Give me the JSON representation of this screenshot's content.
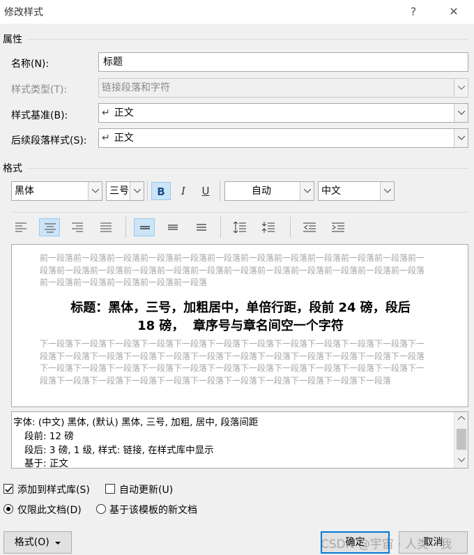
{
  "window": {
    "title": "修改样式",
    "help_glyph": "?",
    "close_glyph": "✕"
  },
  "properties": {
    "section_label": "属性",
    "name_label": "名称(N):",
    "name_value": "标题",
    "type_label": "样式类型(T):",
    "type_value": "链接段落和字符",
    "based_on_label": "样式基准(B):",
    "based_on_value": "正文",
    "next_label": "后续段落样式(S):",
    "next_value": "正文",
    "para_mark": "↵"
  },
  "format": {
    "section_label": "格式",
    "font": "黑体",
    "size": "三号",
    "bold": "B",
    "italic": "I",
    "underline": "U",
    "color": "自动",
    "script": "中文"
  },
  "preview": {
    "before_text": "前一段落前一段落前一段落前一段落前一段落前一段落前一段落前一段落前一段落前一段落前一段落前一段落前一段落前一段落前一段落前一段落前一段落前一段落前一段落前一段落前一段落前一段落前一段落前一段落前一段落前一段落前一段落前一段落",
    "sample_line1": "标题：黑体，三号，加粗居中，单倍行距，段前 24 磅，段后",
    "sample_line2": "18 磅，  章序号与章名间空一个字符",
    "after_text": "下一段落下一段落下一段落下一段落下一段落下一段落下一段落下一段落下一段落下一段落下一段落下一段落下一段落下一段落下一段落下一段落下一段落下一段落下一段落下一段落下一段落下一段落下一段落下一段落下一段落下一段落下一段落下一段落下一段落下一段落下一段落下一段落下一段落下一段落下一段落下一段落下一段落下一段落下一段落下一段落下一段落下一段落下一段落下一段落下一段落"
  },
  "description": {
    "line1": "字体: (中文) 黑体, (默认) 黑体, 三号, 加粗, 居中, 段落间距",
    "line2": "段前: 12 磅",
    "line3": "段后: 3 磅, 1 级, 样式: 链接, 在样式库中显示",
    "line4": "基于: 正文"
  },
  "options": {
    "add_to_gallery": "添加到样式库(S)",
    "add_to_gallery_checked": true,
    "auto_update": "自动更新(U)",
    "auto_update_checked": false,
    "only_this_doc": "仅限此文档(D)",
    "only_this_doc_selected": true,
    "new_docs_template": "基于该模板的新文档",
    "new_docs_template_selected": false
  },
  "buttons": {
    "format": "格式(O)",
    "ok": "确定",
    "cancel": "取消"
  },
  "watermark": "CSDN @宇宙 · 人类 · 我",
  "colors": {
    "accent": "#0078d7",
    "active_bg": "#cce4f7",
    "ghost_text": "#a6a6a6"
  }
}
